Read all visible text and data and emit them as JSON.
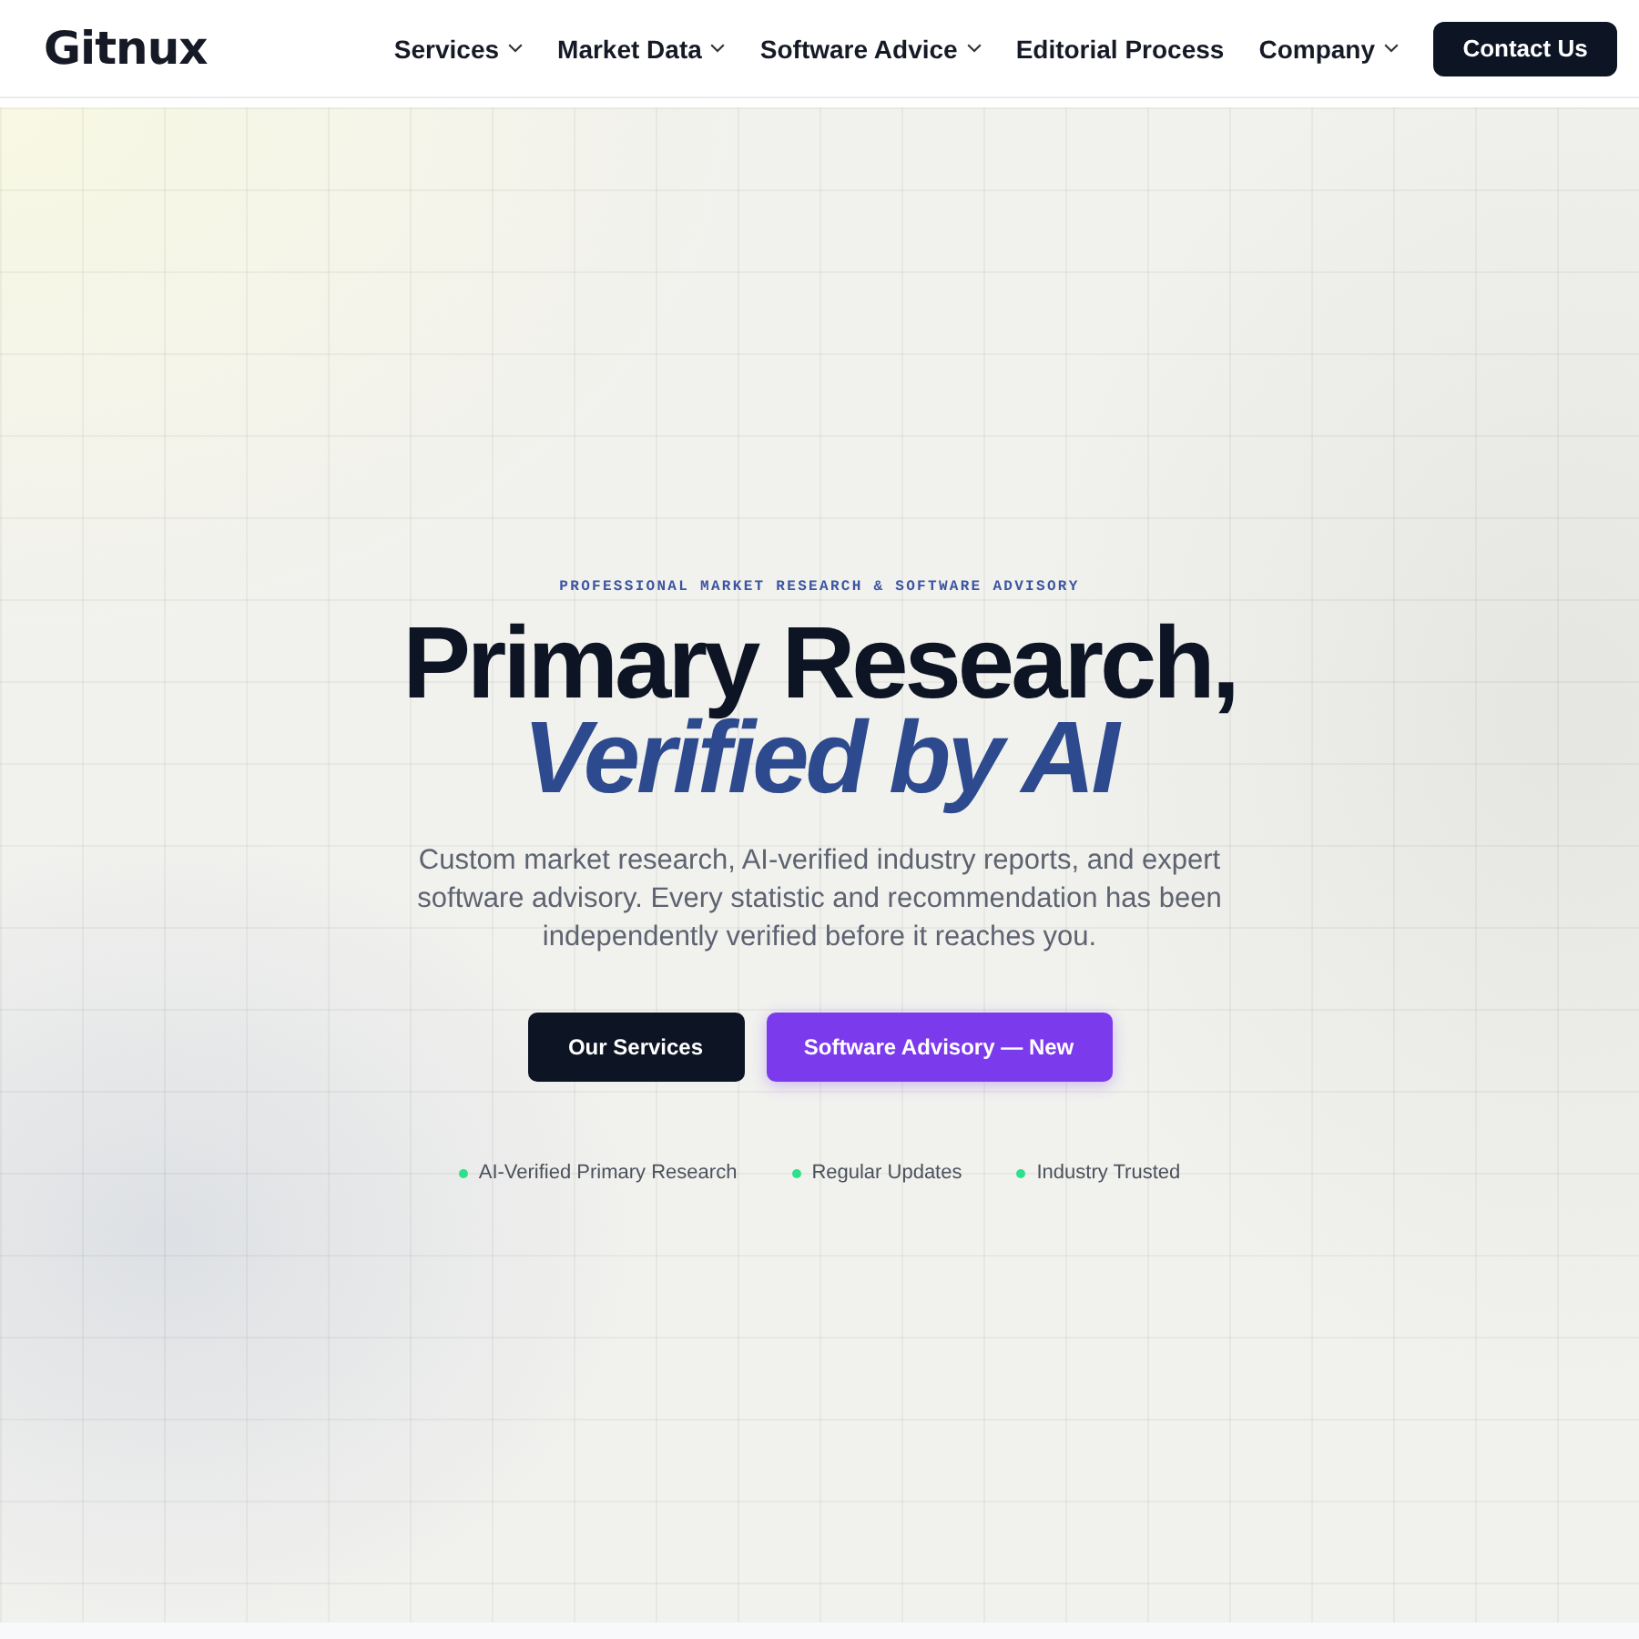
{
  "header": {
    "logo": "Gitnux",
    "nav": [
      {
        "label": "Services",
        "dropdown": true
      },
      {
        "label": "Market Data",
        "dropdown": true
      },
      {
        "label": "Software Advice",
        "dropdown": true
      },
      {
        "label": "Editorial Process",
        "dropdown": false
      },
      {
        "label": "Company",
        "dropdown": true
      }
    ],
    "cta": "Contact Us"
  },
  "hero": {
    "eyebrow": "PROFESSIONAL MARKET RESEARCH & SOFTWARE ADVISORY",
    "title": "Primary Research,",
    "title_highlight": "Verified by AI",
    "description": "Custom market research, AI-verified industry reports, and expert software advisory. Every statistic and recommendation has been independently verified before it reaches you.",
    "buttons": [
      {
        "label": "Our Services",
        "kind": "primary"
      },
      {
        "label": "Software Advisory — New",
        "kind": "accent"
      }
    ],
    "features": [
      "AI-Verified Primary Research",
      "Regular Updates",
      "Industry Trusted"
    ]
  }
}
